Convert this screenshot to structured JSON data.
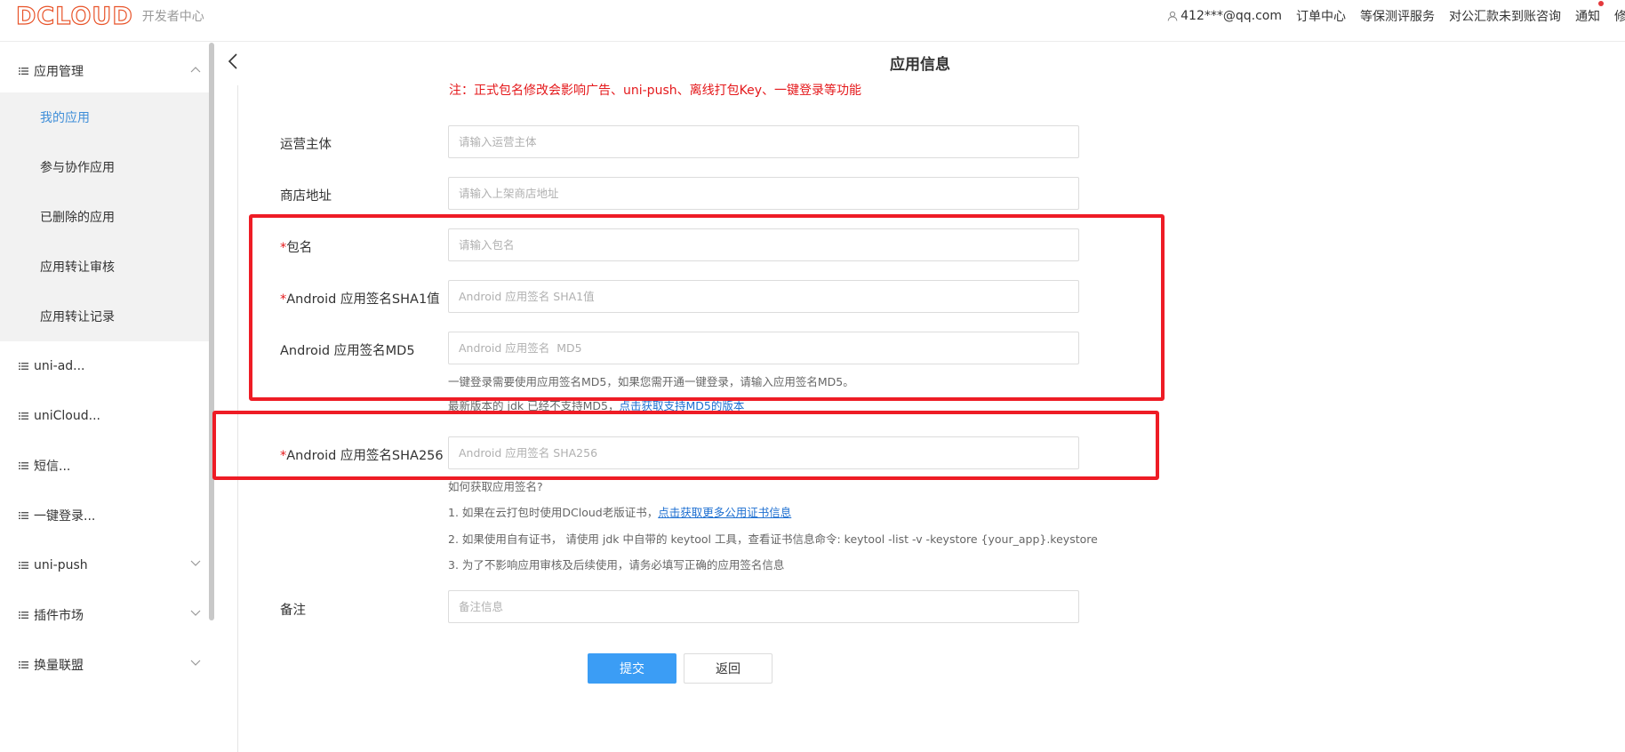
{
  "header": {
    "logo": "DCLOUD",
    "logo_sub": "开发者中心",
    "user": "412***@qq.com",
    "nav": [
      "订单中心",
      "等保测评服务",
      "对公汇款未到账咨询",
      "通知",
      "修改"
    ]
  },
  "sidebar": {
    "group_title": "应用管理",
    "sub_items": [
      "我的应用",
      "参与协作应用",
      "已删除的应用",
      "应用转让审核",
      "应用转让记录"
    ],
    "items": [
      "uni-ad...",
      "uniCloud...",
      "短信...",
      "一键登录...",
      "uni-push",
      "插件市场",
      "换量联盟"
    ]
  },
  "main": {
    "title": "应用信息",
    "notice": "注：正式包名修改会影响广告、uni-push、离线打包Key、一键登录等功能",
    "fields": {
      "operator": {
        "label": "运营主体",
        "placeholder": "请输入运营主体"
      },
      "store": {
        "label": "商店地址",
        "placeholder": "请输入上架商店地址"
      },
      "package": {
        "required": "*",
        "label": "包名",
        "placeholder": "请输入包名"
      },
      "sha1": {
        "required": "*",
        "label": "Android 应用签名SHA1值",
        "placeholder": "Android 应用签名 SHA1值"
      },
      "md5": {
        "label": "Android 应用签名MD5",
        "placeholder": "Android 应用签名  MD5"
      },
      "sha256": {
        "required": "*",
        "label": "Android 应用签名SHA256",
        "placeholder": "Android 应用签名 SHA256"
      },
      "remark": {
        "label": "备注",
        "placeholder": "备注信息"
      }
    },
    "md5_help": "一键登录需要使用应用签名MD5，如果您需开通一键登录，请输入应用签名MD5。",
    "md5_help2_text": "最新版本的 jdk 已经不支持MD5，",
    "md5_help2_link": "点击获取支持MD5的版本",
    "how_to": "如何获取应用签名?",
    "tip1_text": "1. 如果在云打包时使用DCloud老版证书，",
    "tip1_link": "点击获取更多公用证书信息",
    "tip2": "2. 如果使用自有证书， 请使用 jdk 中自带的 keytool 工具，查看证书信息命令: keytool -list -v -keystore {your_app}.keystore",
    "tip3": "3. 为了不影响应用审核及后续使用，请务必填写正确的应用签名信息",
    "submit": "提交",
    "back": "返回"
  }
}
